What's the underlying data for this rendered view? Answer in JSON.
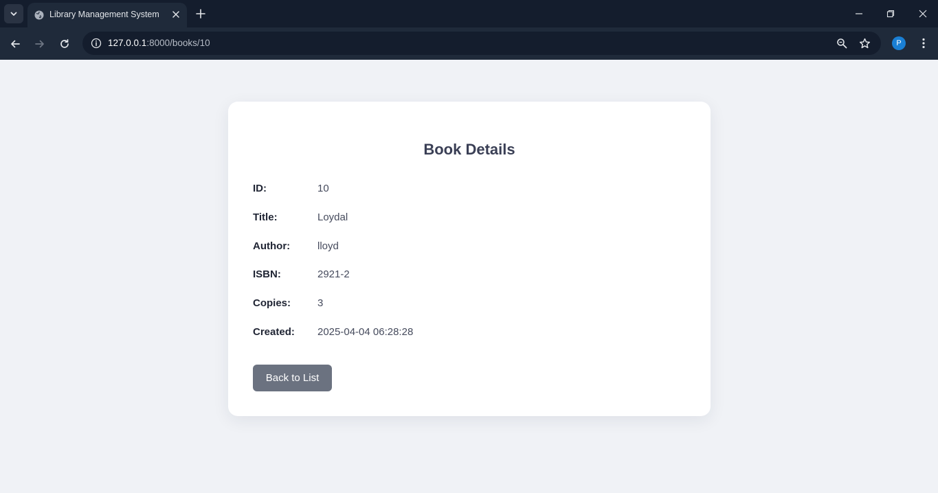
{
  "browser": {
    "tab_title": "Library Management System",
    "url_host": "127.0.0.1",
    "url_path": ":8000/books/10",
    "profile_initial": "P"
  },
  "page": {
    "title": "Book Details",
    "fields": [
      {
        "label": "ID:",
        "value": "10"
      },
      {
        "label": "Title:",
        "value": "Loydal"
      },
      {
        "label": "Author:",
        "value": "lloyd"
      },
      {
        "label": "ISBN:",
        "value": "2921-2"
      },
      {
        "label": "Copies:",
        "value": "3"
      },
      {
        "label": "Created:",
        "value": "2025-04-04 06:28:28"
      }
    ],
    "back_label": "Back to List"
  },
  "colors": {
    "page_bg": "#f0f2f6",
    "card_bg": "#ffffff",
    "button_bg": "#6b7280",
    "chrome_dark": "#141d2d",
    "chrome_toolbar": "#1f2a3a"
  }
}
